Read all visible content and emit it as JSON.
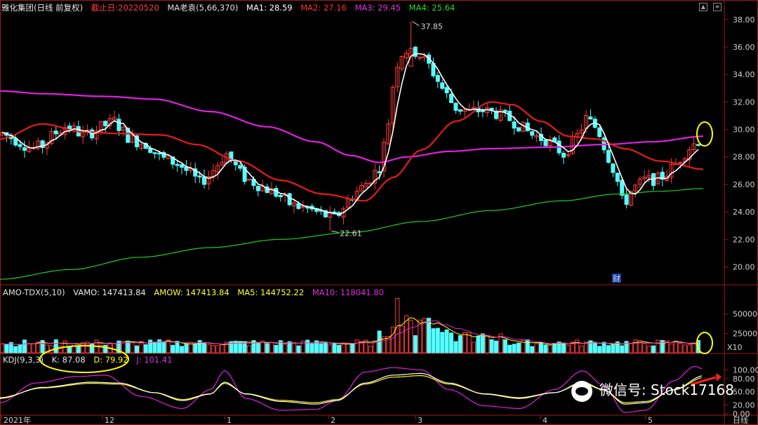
{
  "header": {
    "stock": "雅化集团(日线 前复权)",
    "cutoff": "截止日:20220520",
    "indicator": "MA老袁(5,66,370)",
    "ma1": "MA1: 28.59",
    "ma2": "MA2: 27.16",
    "ma3": "MA3: 29.45",
    "ma4": "MA4: 25.64"
  },
  "volume_header": {
    "name": "AMO-TDX(5,10)",
    "vamo": "VAMO: 147413.84",
    "amow": "AMOW: 147413.84",
    "ma5": "MA5: 144752.22",
    "ma10": "MA10: 118041.80"
  },
  "kdj_header": {
    "name": "KDJ(9,3,3)",
    "k": "K: 87.08",
    "d": "D: 79.92",
    "j": "J: 101.41"
  },
  "right_axis": {
    "price_ticks": [
      "38.00",
      "36.00",
      "34.00",
      "32.00",
      "30.00",
      "28.00",
      "26.00",
      "24.00",
      "22.00",
      "20.00"
    ],
    "volume_ticks": [
      "50000",
      "25000"
    ],
    "volume_unit": "X10",
    "kdj_ticks": [
      "100.00",
      "80.00",
      "50.00",
      "20.00",
      "0.00"
    ],
    "period": "日线"
  },
  "date_axis": [
    "2021年",
    "12",
    "1",
    "2",
    "3",
    "4",
    "5"
  ],
  "annotations": {
    "high": "37.85",
    "low": "22.61",
    "fin_badge": "财"
  },
  "watermark": "微信号: Stock17168",
  "colors": {
    "up": "#ff3b3b",
    "down": "#54ffff",
    "ma1": "#ffffff",
    "ma2": "#e81a1a",
    "ma3": "#e020e0",
    "ma4": "#22cc22",
    "vol_amow": "#ffff00",
    "highlight": "#ffff00"
  },
  "chart_data": {
    "type": "candlestick",
    "price_range": [
      18.8,
      38.6
    ],
    "kdj_range": [
      0,
      115
    ],
    "volume_range": [
      0,
      75000
    ],
    "events": [
      {
        "label": "37.85",
        "value": 37.85
      },
      {
        "label": "22.61",
        "value": 22.61
      }
    ]
  }
}
